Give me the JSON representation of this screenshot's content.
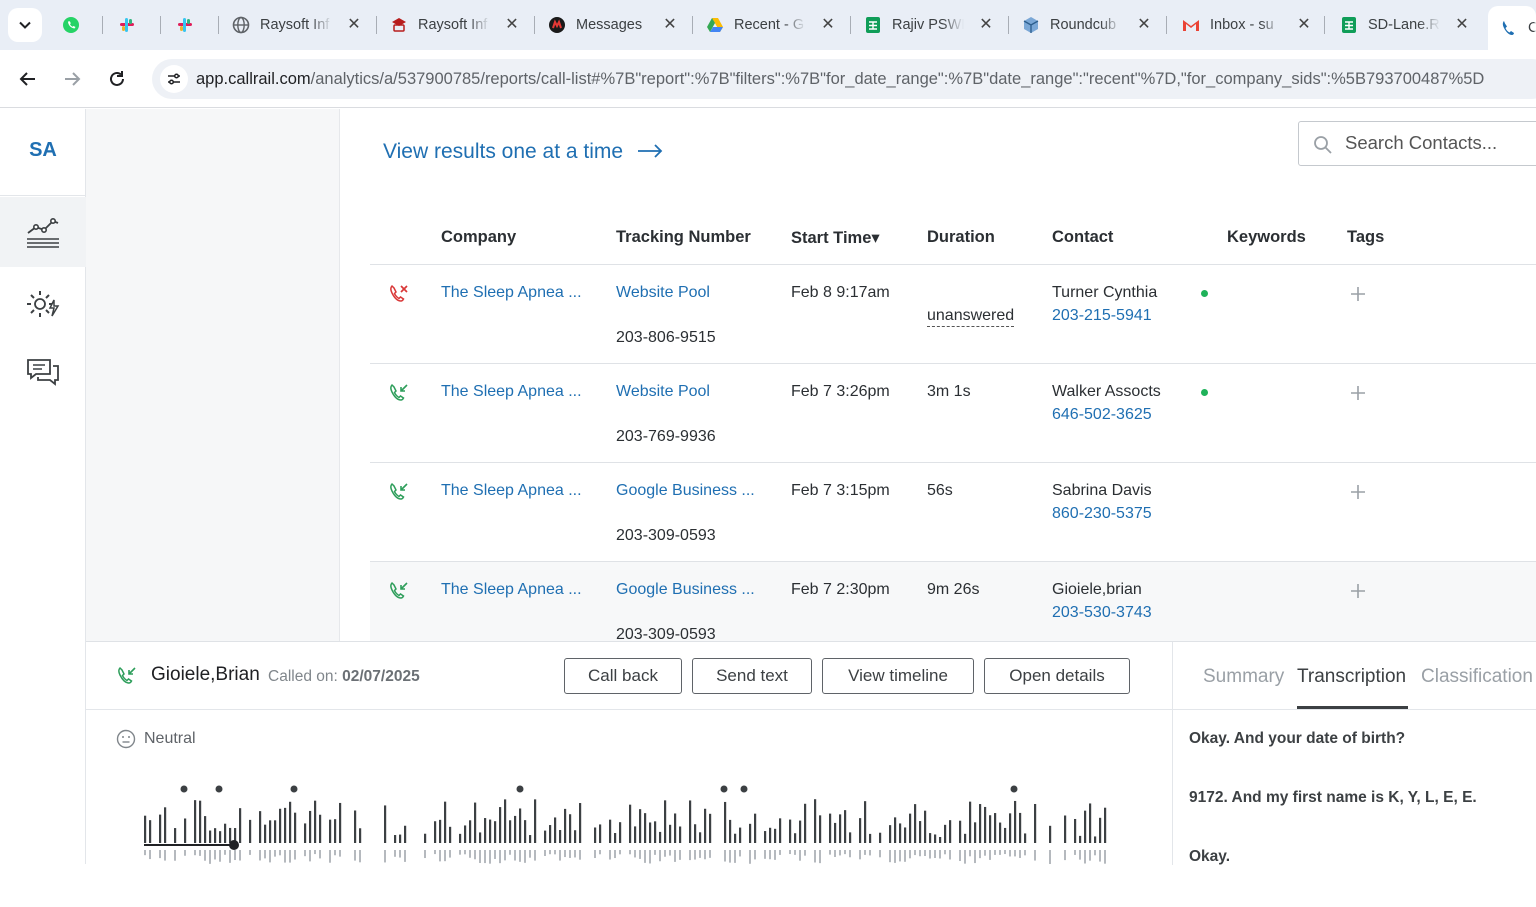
{
  "browser": {
    "tabs": [
      {
        "label": "",
        "icon": "whatsapp-icon"
      },
      {
        "label": "",
        "icon": "slack-icon"
      },
      {
        "label": "",
        "icon": "slack-icon"
      },
      {
        "label": "Raysoft Inf",
        "icon": "globe-icon"
      },
      {
        "label": "Raysoft Inf",
        "icon": "raysoft-icon"
      },
      {
        "label": "Messages",
        "icon": "messages-icon"
      },
      {
        "label": "Recent - G",
        "icon": "google-drive-icon"
      },
      {
        "label": "Rajiv PSWF",
        "icon": "google-sheets-icon"
      },
      {
        "label": "Roundcub",
        "icon": "roundcube-icon"
      },
      {
        "label": "Inbox - su",
        "icon": "gmail-icon"
      },
      {
        "label": "SD-Lane.R",
        "icon": "google-sheets-icon"
      },
      {
        "label": "C",
        "icon": "callrail-icon"
      }
    ],
    "url_host": "app.callrail.com",
    "url_path": "/analytics/a/537900785/reports/call-list#%7B\"report\":%7B\"filters\":%7B\"for_date_range\":%7B\"date_range\":\"recent\"%7D,\"for_company_sids\":%5B793700487%5D"
  },
  "rail": {
    "logo": "SA",
    "items": [
      "analytics-icon",
      "settings-automation-icon",
      "conversations-icon"
    ]
  },
  "main": {
    "view_link": "View results one at a time",
    "search_placeholder": "Search Contacts...",
    "columns": {
      "company": "Company",
      "tracking": "Tracking Number",
      "start": "Start Time▾",
      "duration": "Duration",
      "contact": "Contact",
      "keywords": "Keywords",
      "tags": "Tags"
    },
    "rows": [
      {
        "type": "missed",
        "company": "The Sleep Apnea ...",
        "source": "Website Pool",
        "tracking_number": "203-806-9515",
        "start": "Feb 8 9:17am",
        "duration": "unanswered",
        "contact": "Turner Cynthia",
        "phone": "203-215-5941",
        "online": true
      },
      {
        "type": "answered",
        "company": "The Sleep Apnea ...",
        "source": "Website Pool",
        "tracking_number": "203-769-9936",
        "start": "Feb 7 3:26pm",
        "duration": "3m 1s",
        "contact": "Walker Assocts",
        "phone": "646-502-3625",
        "online": true
      },
      {
        "type": "answered",
        "company": "The Sleep Apnea ...",
        "source": "Google Business ...",
        "tracking_number": "203-309-0593",
        "start": "Feb 7 3:15pm",
        "duration": "56s",
        "contact": "Sabrina Davis",
        "phone": "860-230-5375",
        "online": false
      },
      {
        "type": "answered",
        "company": "The Sleep Apnea ...",
        "source": "Google Business ...",
        "tracking_number": "203-309-0593",
        "start": "Feb 7 2:30pm",
        "duration": "9m 26s",
        "contact": "Gioiele,brian",
        "phone": "203-530-3743",
        "online": false
      }
    ]
  },
  "call_panel": {
    "name": "Gioiele,Brian",
    "called_label": "Called on:",
    "called_date": "02/07/2025",
    "buttons": {
      "call_back": "Call back",
      "send_text": "Send text",
      "view_timeline": "View timeline",
      "open_details": "Open details"
    },
    "sentiment": "Neutral",
    "tabs": {
      "summary": "Summary",
      "transcription": "Transcription",
      "classification": "Classification"
    },
    "active_tab": "Transcription",
    "transcript": [
      "Okay. And your date of birth?",
      "9172. And my first name is K, Y, L, E, E.",
      "Okay."
    ]
  },
  "colors": {
    "accent": "#1f6fb2",
    "answered": "#2e9e5b",
    "missed": "#d93838",
    "online": "#1fb25a"
  }
}
